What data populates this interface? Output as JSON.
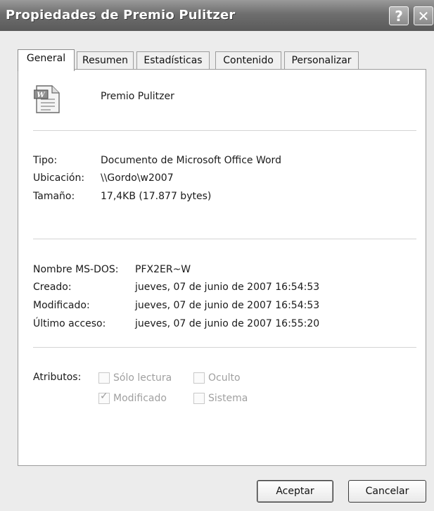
{
  "window": {
    "title": "Propiedades de Premio Pulitzer",
    "help_glyph": "?",
    "close_glyph": "✕"
  },
  "tabs": [
    {
      "label": "General",
      "active": true
    },
    {
      "label": "Resumen",
      "active": false
    },
    {
      "label": "Estadísticas",
      "active": false
    },
    {
      "label": "Contenido",
      "active": false
    },
    {
      "label": "Personalizar",
      "active": false
    }
  ],
  "file": {
    "icon": "word-document-icon",
    "name": "Premio Pulitzer"
  },
  "info": {
    "tipo_label": "Tipo:",
    "tipo_value": "Documento de Microsoft Office Word",
    "ubicacion_label": "Ubicación:",
    "ubicacion_value": "\\\\Gordo\\w2007",
    "tamano_label": "Tamaño:",
    "tamano_value": "17,4KB (17.877 bytes)"
  },
  "dates": {
    "msdos_label": "Nombre MS-DOS:",
    "msdos_value": "PFX2ER~W",
    "creado_label": "Creado:",
    "creado_value": "jueves, 07 de junio de 2007 16:54:53",
    "modificado_label": "Modificado:",
    "modificado_value": "jueves, 07 de junio de 2007 16:54:53",
    "acceso_label": "Último acceso:",
    "acceso_value": "jueves, 07 de junio de 2007 16:55:20"
  },
  "attributes": {
    "label": "Atributos:",
    "solo_lectura": {
      "label": "Sólo lectura",
      "checked": false
    },
    "oculto": {
      "label": "Oculto",
      "checked": false
    },
    "modificado": {
      "label": "Modificado",
      "checked": true
    },
    "sistema": {
      "label": "Sistema",
      "checked": false
    }
  },
  "buttons": {
    "ok": "Aceptar",
    "cancel": "Cancelar"
  },
  "colors": {
    "titlebar": "#6e6e6e",
    "panel": "#ffffff",
    "window": "#ececec"
  }
}
